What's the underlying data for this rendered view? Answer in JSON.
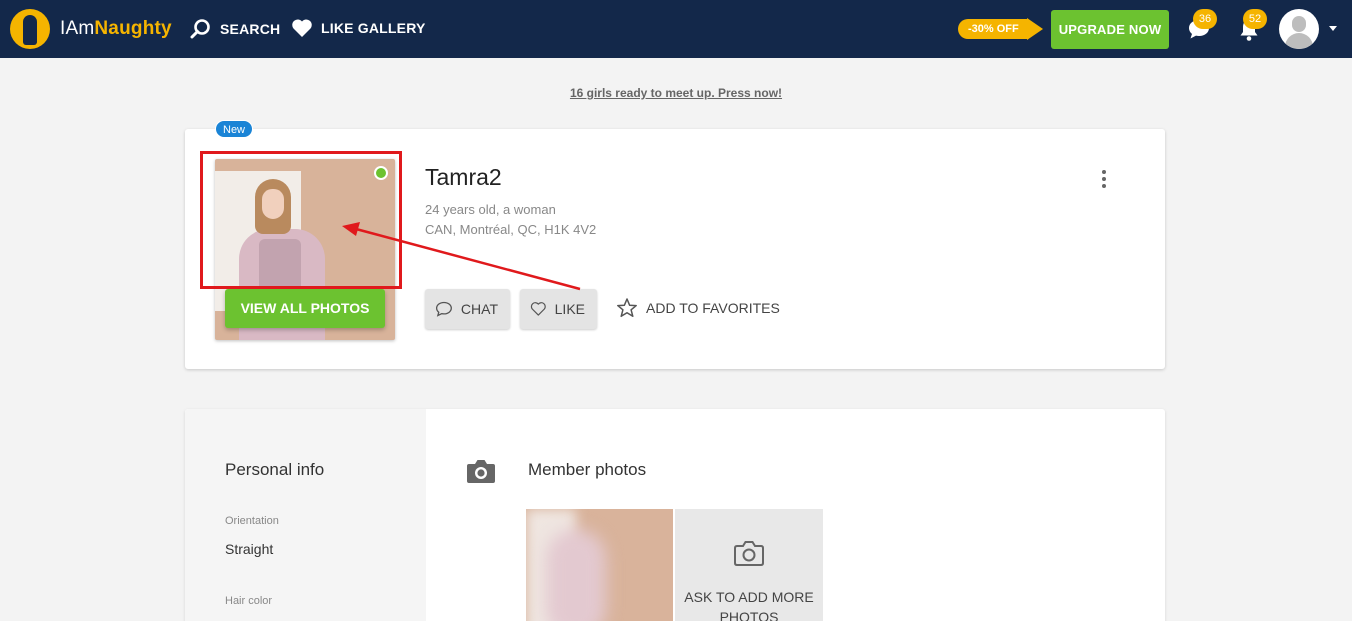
{
  "header": {
    "logo_text_plain": "IAm",
    "logo_text_bold": "Naughty",
    "nav": [
      {
        "label": "SEARCH",
        "icon": "search-icon"
      },
      {
        "label": "LIKE GALLERY",
        "icon": "heart-icon"
      }
    ],
    "discount_label": "-30% OFF",
    "upgrade_label": "UPGRADE NOW",
    "messages_count": "36",
    "notifications_count": "52"
  },
  "promo": {
    "text": "16 girls ready to meet up. Press now!"
  },
  "profile": {
    "badge": "New",
    "username": "Tamra2",
    "age_gender": "24 years old, a woman",
    "location": "CAN, Montréal, QC, H1K 4V2",
    "online": true,
    "view_photos_label": "VIEW ALL PHOTOS",
    "actions": {
      "chat": "CHAT",
      "like": "LIKE",
      "favorite": "ADD TO FAVORITES"
    }
  },
  "personal_info": {
    "title": "Personal info",
    "fields": [
      {
        "label": "Orientation",
        "value": "Straight"
      },
      {
        "label": "Hair color",
        "value": ""
      }
    ]
  },
  "member_photos": {
    "title": "Member photos",
    "ask_more_label": "ASK TO ADD MORE PHOTOS"
  },
  "colors": {
    "header_bg": "#13284a",
    "accent_yellow": "#f5b400",
    "accent_green": "#6cc230",
    "new_badge_blue": "#1a84d6",
    "annotation_red": "#e0191c"
  }
}
